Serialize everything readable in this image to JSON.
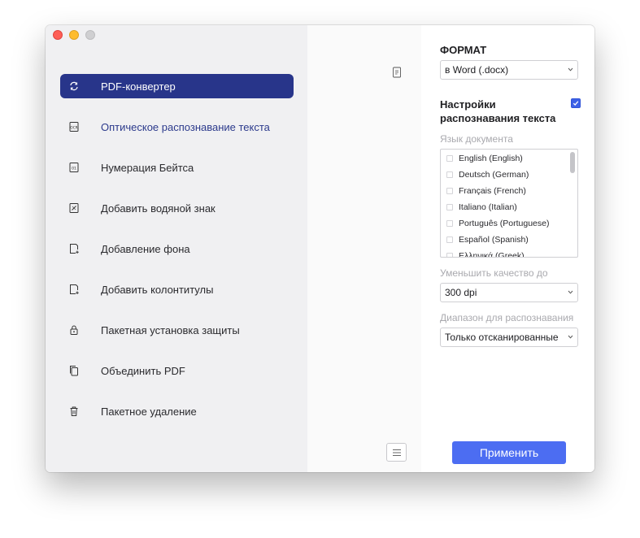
{
  "colors": {
    "active_nav_bg": "#28358a",
    "hover_nav_text": "#2c3a8c",
    "accent_button": "#4c6df2",
    "checkbox_checked": "#3d61e6"
  },
  "sidebar": {
    "items": [
      {
        "label": "PDF-конвертер",
        "icon": "convert-cycle-icon",
        "state": "active"
      },
      {
        "label": "Оптическое распознавание текста",
        "icon": "ocr-icon",
        "state": "hover"
      },
      {
        "label": "Нумерация Бейтса",
        "icon": "bates-number-icon",
        "state": ""
      },
      {
        "label": "Добавить водяной знак",
        "icon": "watermark-icon",
        "state": ""
      },
      {
        "label": "Добавление фона",
        "icon": "background-icon",
        "state": ""
      },
      {
        "label": "Добавить колонтитулы",
        "icon": "header-footer-icon",
        "state": ""
      },
      {
        "label": "Пакетная установка защиты",
        "icon": "lock-icon",
        "state": ""
      },
      {
        "label": "Объединить PDF",
        "icon": "combine-icon",
        "state": ""
      },
      {
        "label": "Пакетное удаление",
        "icon": "trash-icon",
        "state": ""
      }
    ]
  },
  "panel": {
    "format_title": "ФОРМАТ",
    "format_value": "в Word (.docx)",
    "ocr_settings_line1": "Настройки",
    "ocr_settings_line2": "распознавания текста",
    "ocr_enabled": true,
    "doc_language_label": "Язык документа",
    "languages": [
      "English (English)",
      "Deutsch (German)",
      "Français (French)",
      "Italiano (Italian)",
      "Português (Portuguese)",
      "Español (Spanish)",
      "Ελληνικά (Greek)"
    ],
    "reduce_quality_label": "Уменьшить качество до",
    "dpi_value": "300 dpi",
    "range_label": "Диапазон для распознавания",
    "range_value": "Только отсканированные",
    "apply_label": "Применить"
  }
}
